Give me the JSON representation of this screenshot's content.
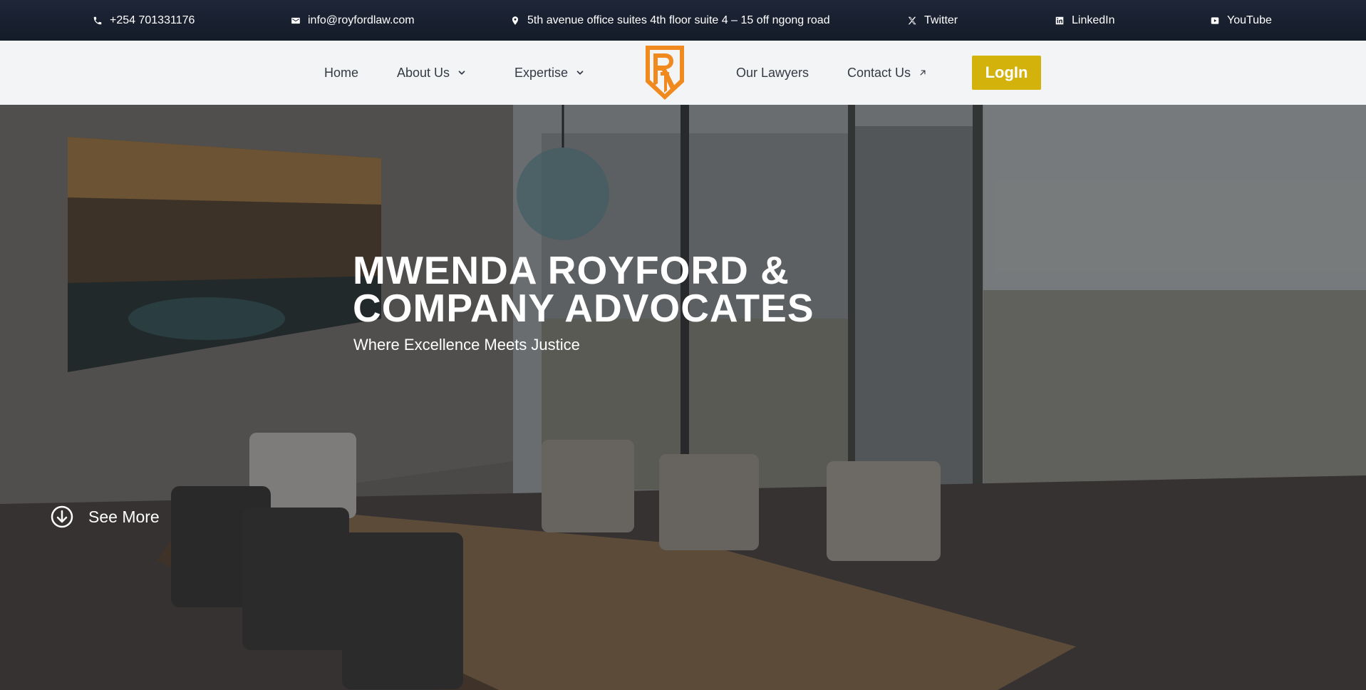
{
  "topbar": {
    "phone": "+254 701331176",
    "email": "info@royfordlaw.com",
    "address": "5th avenue office suites 4th floor suite 4 – 15 off ngong road",
    "twitter": "Twitter",
    "linkedin": "LinkedIn",
    "youtube": "YouTube",
    "icons": [
      "phone-icon",
      "mail-icon",
      "location-pin-icon",
      "x-twitter-icon",
      "linkedin-icon",
      "youtube-icon"
    ]
  },
  "nav": {
    "home": "Home",
    "about": "About Us",
    "expertise": "Expertise",
    "lawyers": "Our Lawyers",
    "contact": "Contact Us",
    "login": "LogIn"
  },
  "hero": {
    "title_line1": "MWENDA ROYFORD &",
    "title_line2": "COMPANY ADVOCATES",
    "subtitle": "Where Excellence Meets Justice",
    "see_more": "See More"
  },
  "colors": {
    "topbar_bg": "#1a2130",
    "navbar_bg": "#f3f4f6",
    "login_bg": "#d4b20c",
    "logo_orange": "#f08a1e"
  }
}
